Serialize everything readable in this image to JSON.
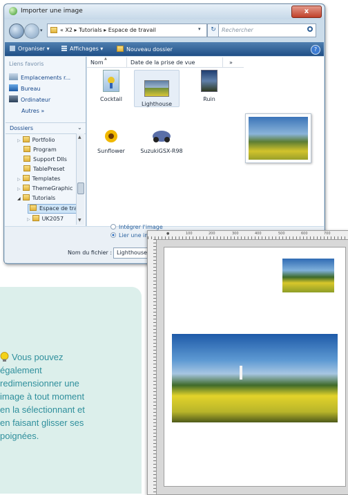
{
  "dialog": {
    "title": "Importer une image",
    "close_label": "x",
    "address": {
      "path": "«  X2  ▸  Tutorials  ▸  Espace de travail",
      "search_placeholder": "Rechercher"
    },
    "toolbar": {
      "organize": "Organiser  ▾",
      "views": "Affichages  ▾",
      "new_folder": "Nouveau dossier",
      "help": "?"
    },
    "favorites": {
      "header": "Liens favoris",
      "items": [
        {
          "label": "Emplacements r...",
          "icon": "recent-places-icon"
        },
        {
          "label": "Bureau",
          "icon": "desktop-icon"
        },
        {
          "label": "Ordinateur",
          "icon": "computer-icon"
        }
      ],
      "more": "Autres  »"
    },
    "folders": {
      "header": "Dossiers",
      "items": [
        "Portfolio",
        "Program",
        "Support Dlls",
        "TablePreset",
        "Templates",
        "ThemeGraphic",
        "Tutorials",
        "Espace de tra",
        "UK2057"
      ]
    },
    "columns": {
      "name": "Nom",
      "date": "Date de la prise de vue",
      "more": "»"
    },
    "files": [
      {
        "name": "Cocktail",
        "icon": "cocktail-thumbnail"
      },
      {
        "name": "Lighthouse",
        "icon": "lighthouse-thumbnail"
      },
      {
        "name": "Ruin",
        "icon": "ruin-thumbnail"
      },
      {
        "name": "Sunflower",
        "icon": "sunflower-thumbnail"
      },
      {
        "name": "SuzukiGSX-R98",
        "icon": "motorcycle-thumbnail"
      }
    ],
    "options": {
      "embed": "Intégrer l'image",
      "link": "Lier une ima"
    },
    "filename": {
      "label": "Nom du fichier :",
      "value": "Lighthouse"
    }
  },
  "ruler": {
    "ticks": [
      "100",
      "200",
      "300",
      "400",
      "500",
      "600",
      "700"
    ]
  },
  "tip": {
    "text": "Vous pouvez\négalement\nredimensionner une\nimage à tout moment\nen la sélectionnant et\nen faisant glisser ses\npoignées."
  },
  "colors": {
    "tip_text": "#2f8f9c",
    "tip_bg": "#dcefeb",
    "toolbar": "#1f4f86"
  }
}
